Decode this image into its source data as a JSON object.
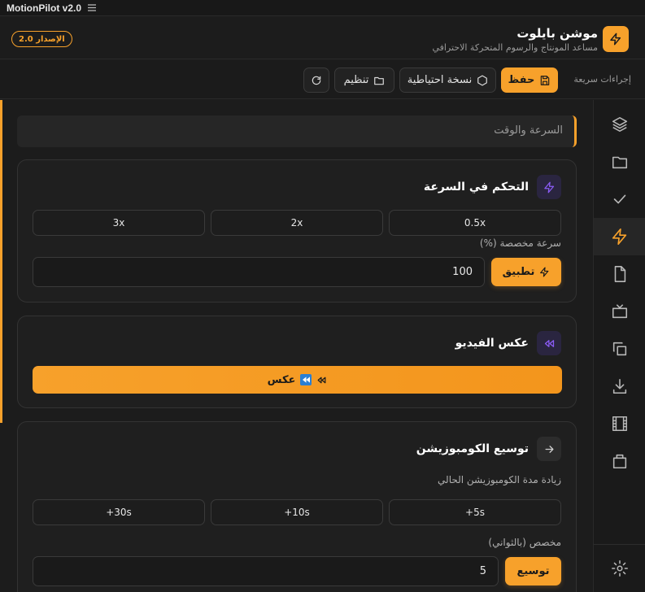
{
  "window": {
    "title": "MotionPilot v2.0"
  },
  "header": {
    "brand_name": "موشن بايلوت",
    "brand_subtitle": "مساعد المونتاج والرسوم المتحركة الاحترافي",
    "version_badge": "الإصدار 2.0"
  },
  "toolbar": {
    "quick_actions_label": "إجراءات سريعة",
    "save_label": "حفظ",
    "backup_label": "نسخة احتياطية",
    "organize_label": "تنظيم"
  },
  "sidebar": {
    "items": [
      "layers-icon",
      "folder-icon",
      "check-icon",
      "lightning-icon",
      "file-icon",
      "tv-icon",
      "copy-icon",
      "download-icon",
      "film-icon",
      "package-icon"
    ],
    "active": "lightning-icon",
    "settings": "gear-icon"
  },
  "section": {
    "title": "السرعة والوقت"
  },
  "speed_card": {
    "title": "التحكم في السرعة",
    "presets": [
      "0.5x",
      "2x",
      "3x"
    ],
    "custom_label": "سرعة مخصصة (%)",
    "custom_value": "100",
    "apply_label": "تطبيق"
  },
  "reverse_card": {
    "title": "عكس الفيديو",
    "button_label": "عكس"
  },
  "extend_card": {
    "title": "توسيع الكومبوزيشن",
    "description": "زيادة مدة الكومبوزيشن الحالي",
    "presets": [
      "+5s",
      "+10s",
      "+30s"
    ],
    "custom_label": "مخصص (بالثواني)",
    "custom_value": "5",
    "extend_label": "توسيع"
  },
  "colors": {
    "accent": "#f7a12b",
    "background": "#1c1c1c",
    "card": "#1f1f1f",
    "icon_purple": "#8b5cf6"
  }
}
